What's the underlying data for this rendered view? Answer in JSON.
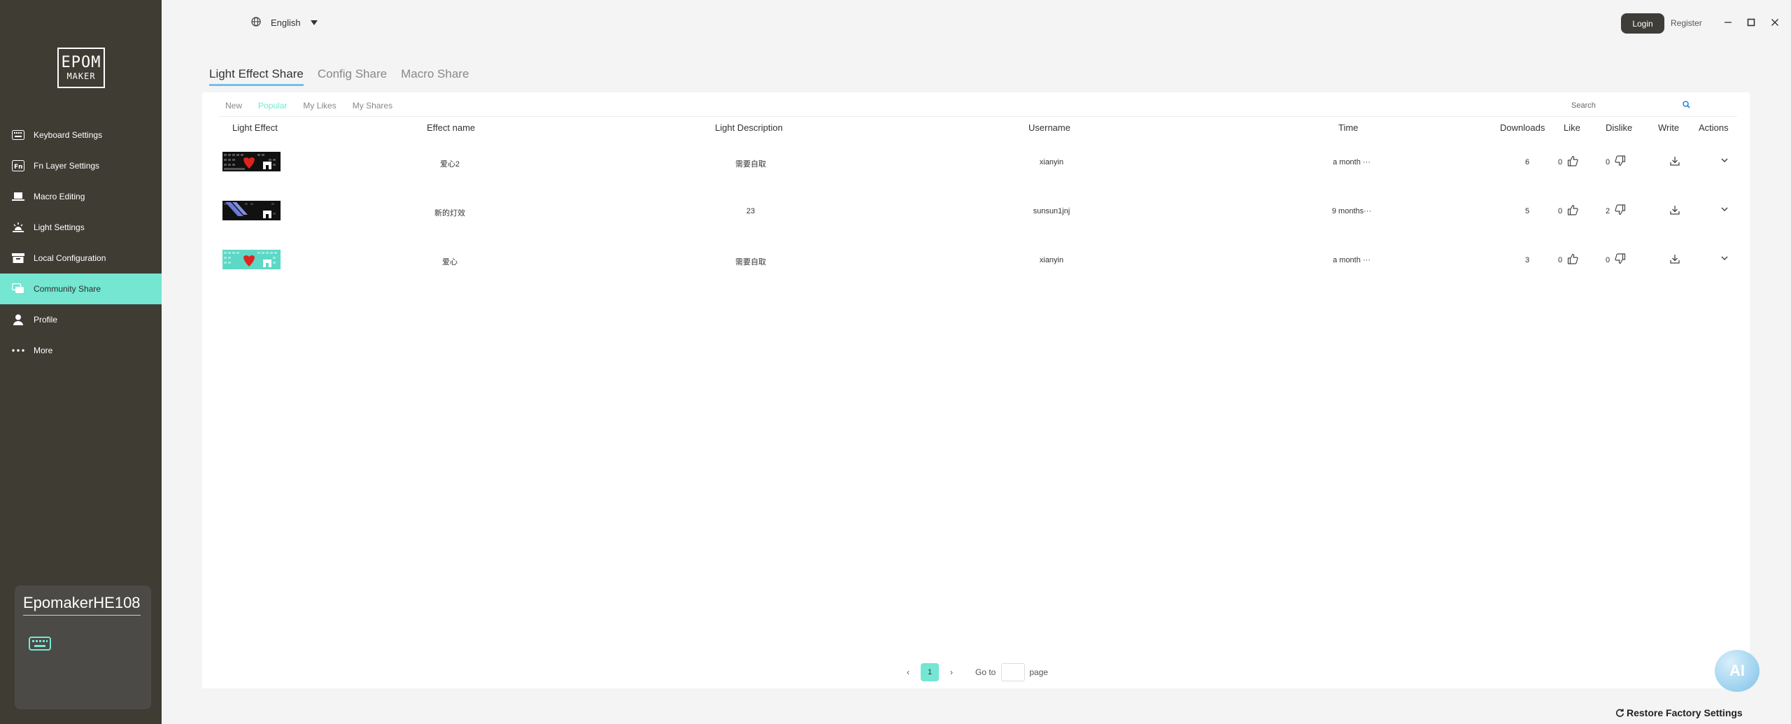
{
  "app": {
    "logo": {
      "line1": "EPOM",
      "line2": "MAKER"
    },
    "language": "English",
    "login_label": "Login",
    "register_label": "Register"
  },
  "sidebar": {
    "items": [
      {
        "label": "Keyboard Settings",
        "icon": "keyboard-icon",
        "active": false
      },
      {
        "label": "Fn Layer Settings",
        "icon": "fn-icon",
        "active": false
      },
      {
        "label": "Macro Editing",
        "icon": "laptop-icon",
        "active": false
      },
      {
        "label": "Light Settings",
        "icon": "light-icon",
        "active": false
      },
      {
        "label": "Local Configuration",
        "icon": "archive-icon",
        "active": false
      },
      {
        "label": "Community Share",
        "icon": "chat-icon",
        "active": true
      },
      {
        "label": "Profile",
        "icon": "user-icon",
        "active": false
      },
      {
        "label": "More",
        "icon": "more-icon",
        "active": false
      }
    ],
    "device_name": "EpomakerHE108"
  },
  "main_tabs": [
    "Light Effect Share",
    "Config Share",
    "Macro Share"
  ],
  "sub_tabs": [
    "New",
    "Popular",
    "My Likes",
    "My Shares"
  ],
  "search_placeholder": "Search",
  "table": {
    "headers": {
      "light_effect": "Light Effect",
      "effect_name": "Effect name",
      "description": "Light Description",
      "username": "Username",
      "time": "Time",
      "downloads": "Downloads",
      "like": "Like",
      "dislike": "Dislike",
      "write": "Write",
      "actions": "Actions"
    },
    "rows": [
      {
        "effect_name": "爱心2",
        "description": "需要自取",
        "username": "xianyin",
        "time": "a month ···",
        "downloads": "6",
        "likes": "0",
        "dislikes": "0",
        "thumb": "dark-heart"
      },
      {
        "effect_name": "新的灯效",
        "description": "23",
        "username": "sunsun1jnj",
        "time": "9 months···",
        "downloads": "5",
        "likes": "0",
        "dislikes": "2",
        "thumb": "dark-wave"
      },
      {
        "effect_name": "爱心",
        "description": "需要自取",
        "username": "xianyin",
        "time": "a month ···",
        "downloads": "3",
        "likes": "0",
        "dislikes": "0",
        "thumb": "cyan-heart"
      }
    ]
  },
  "pagination": {
    "current_page": "1",
    "goto_label": "Go to",
    "page_label": "page"
  },
  "restore_label": "Restore Factory Settings",
  "ai_label": "AI",
  "colors": {
    "accent": "#74e6d2",
    "sidebar_bg": "#3f3c34",
    "tab_underline": "#74c0e6"
  }
}
